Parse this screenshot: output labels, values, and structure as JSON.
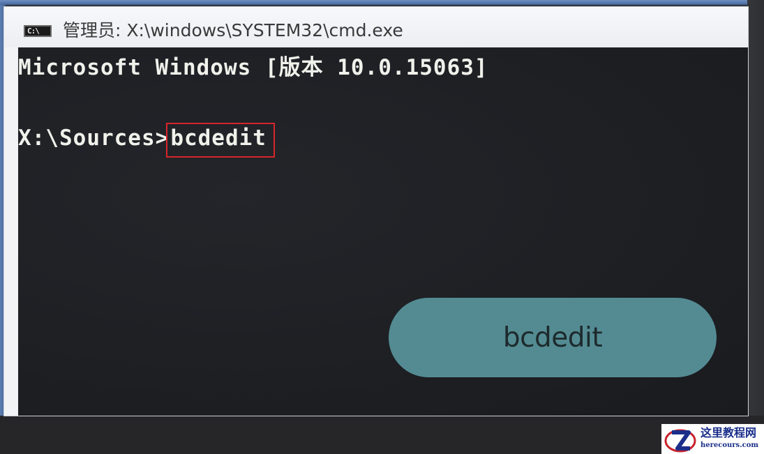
{
  "window": {
    "title": "管理员: X:\\windows\\SYSTEM32\\cmd.exe",
    "icon_text": "C:\\"
  },
  "console": {
    "line1": "Microsoft Windows [版本 10.0.15063]",
    "prompt": "X:\\Sources>",
    "command": "bcdedit"
  },
  "callout": {
    "label": "bcdedit"
  },
  "watermark": {
    "name": "这里教程网",
    "url": "herecours.com"
  },
  "colors": {
    "console_bg": "#1d1f23",
    "highlight_border": "#d6262b",
    "pill_bg": "#548b93"
  }
}
